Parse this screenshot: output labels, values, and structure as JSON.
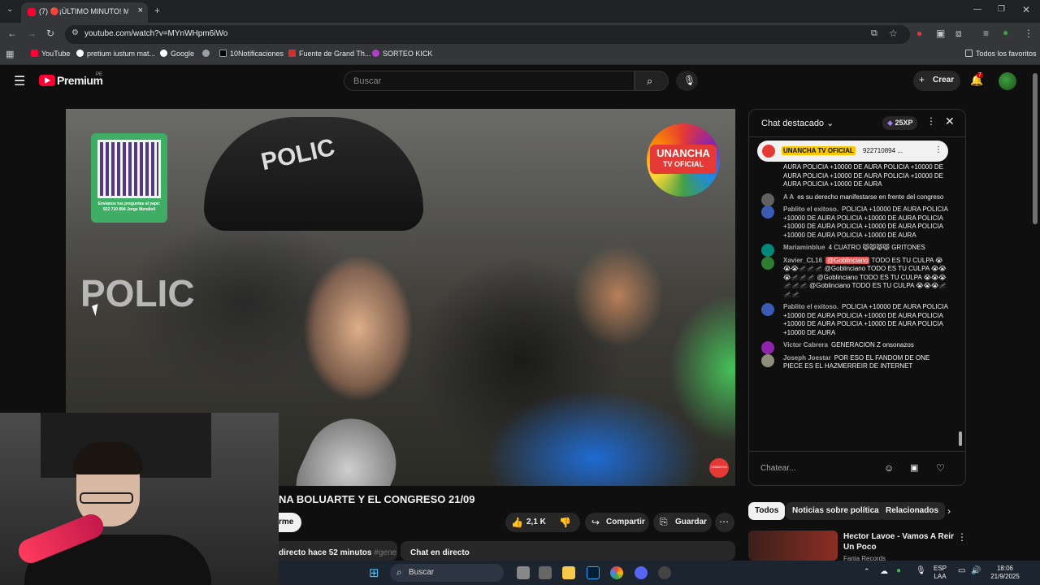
{
  "browser": {
    "tab_title": "(7) 🔴¡ÚLTIMO MINUTO! M",
    "url": "youtube.com/watch?v=MYnWHpm6iWo",
    "bookmarks": [
      "YouTube",
      "pretium iustum mat...",
      "Google",
      "10Notificaciones",
      "Fuente de Grand Th...",
      "SORTEO KICK"
    ],
    "all_favorites": "Todos los favoritos"
  },
  "header": {
    "logo": "Premium",
    "region": "PE",
    "search_placeholder": "Buscar",
    "create_label": "Crear",
    "notification_count": "7"
  },
  "video": {
    "helmet_text": "POLIC",
    "shield_text": "POLIC",
    "qr_caption": "Envianos tus preguntas al yape: 922 710 894 Jorge Mendivil",
    "channel_logo_line1": "UNANCHA",
    "channel_logo_line2": "TV OFICIAL",
    "watermark": "UNANCHA"
  },
  "below_video": {
    "title": "NA BOLUARTE Y EL CONGRESO 21/09",
    "subscribe_label": "rme",
    "likes": "2,1 K",
    "share_label": "Compartir",
    "save_label": "Guardar",
    "desc_label": "directo hace 52 minutos",
    "desc_tag": "#gene",
    "chat_live_label": "Chat en directo"
  },
  "chat": {
    "title": "Chat destacado",
    "xp_label": "25XP",
    "pinned_author": "UNANCHA TV OFICIAL",
    "pinned_message": "922710894 ...",
    "input_placeholder": "Chatear...",
    "messages": [
      {
        "author": "",
        "text": "AURA POLICIA +10000 DE AURA POLICIA +10000 DE AURA POLICIA +10000 DE AURA POLICIA +10000 DE AURA POLICIA +10000 DE AURA",
        "color": "#0f0f0f"
      },
      {
        "author": "A A",
        "text": "es su derecho manifestarse en frente del congreso",
        "color": "#606060"
      },
      {
        "author": "Pablito el exitoso.",
        "text": "POLICIA +10000 DE AURA POLICIA +10000 DE AURA POLICIA +10000 DE AURA POLICIA +10000 DE AURA POLICIA +10000 DE AURA POLICIA +10000 DE AURA POLICIA +10000 DE AURA",
        "color": "#3b5bb5"
      },
      {
        "author": "Mariaminblue",
        "text": "4 CUATRO 😾😾😾😾 GRITONES",
        "color": "#00897b"
      },
      {
        "author": "Xavier_CL16",
        "mention": "@Goblinciano",
        "text": "TODO ES TU CULPA 😭😭😭🦟🦟🦟 @Goblinciano TODO ES TU CULPA 😭😭😭🦟🦟🦟 @Goblinciano TODO ES TU CULPA 😭😭😭🦟🦟🦟 @Goblinciano TODO ES TU CULPA 😭😭😭🦟🦟🦟",
        "color": "#2e7d32"
      },
      {
        "author": "Pablito el exitoso.",
        "text": "POLICIA +10000 DE AURA POLICIA +10000 DE AURA POLICIA +10000 DE AURA POLICIA +10000 DE AURA POLICIA +10000 DE AURA POLICIA +10000 DE AURA",
        "color": "#3b5bb5"
      },
      {
        "author": "Victor Cabrera",
        "text": "GENERACION Z onsonazos",
        "color": "#8e24aa"
      },
      {
        "author": "Joseph Joestar",
        "text": "POR ESO EL FANDOM DE ONE PIECE ES EL HAZMERREIR DE INTERNET",
        "color": "#8d8d7a"
      }
    ]
  },
  "chips": [
    "Todos",
    "Noticias sobre política",
    "Relacionados"
  ],
  "related": {
    "title": "Hector Lavoe - Vamos A Reir Un Poco",
    "channel": "Fania Records"
  },
  "taskbar": {
    "search_label": "Buscar",
    "lang": "ESP",
    "lang2": "LAA",
    "time": "18:06",
    "date": "21/9/2025"
  },
  "colors": {
    "youtube_red": "#ff0033",
    "background": "#0f0f0f"
  }
}
